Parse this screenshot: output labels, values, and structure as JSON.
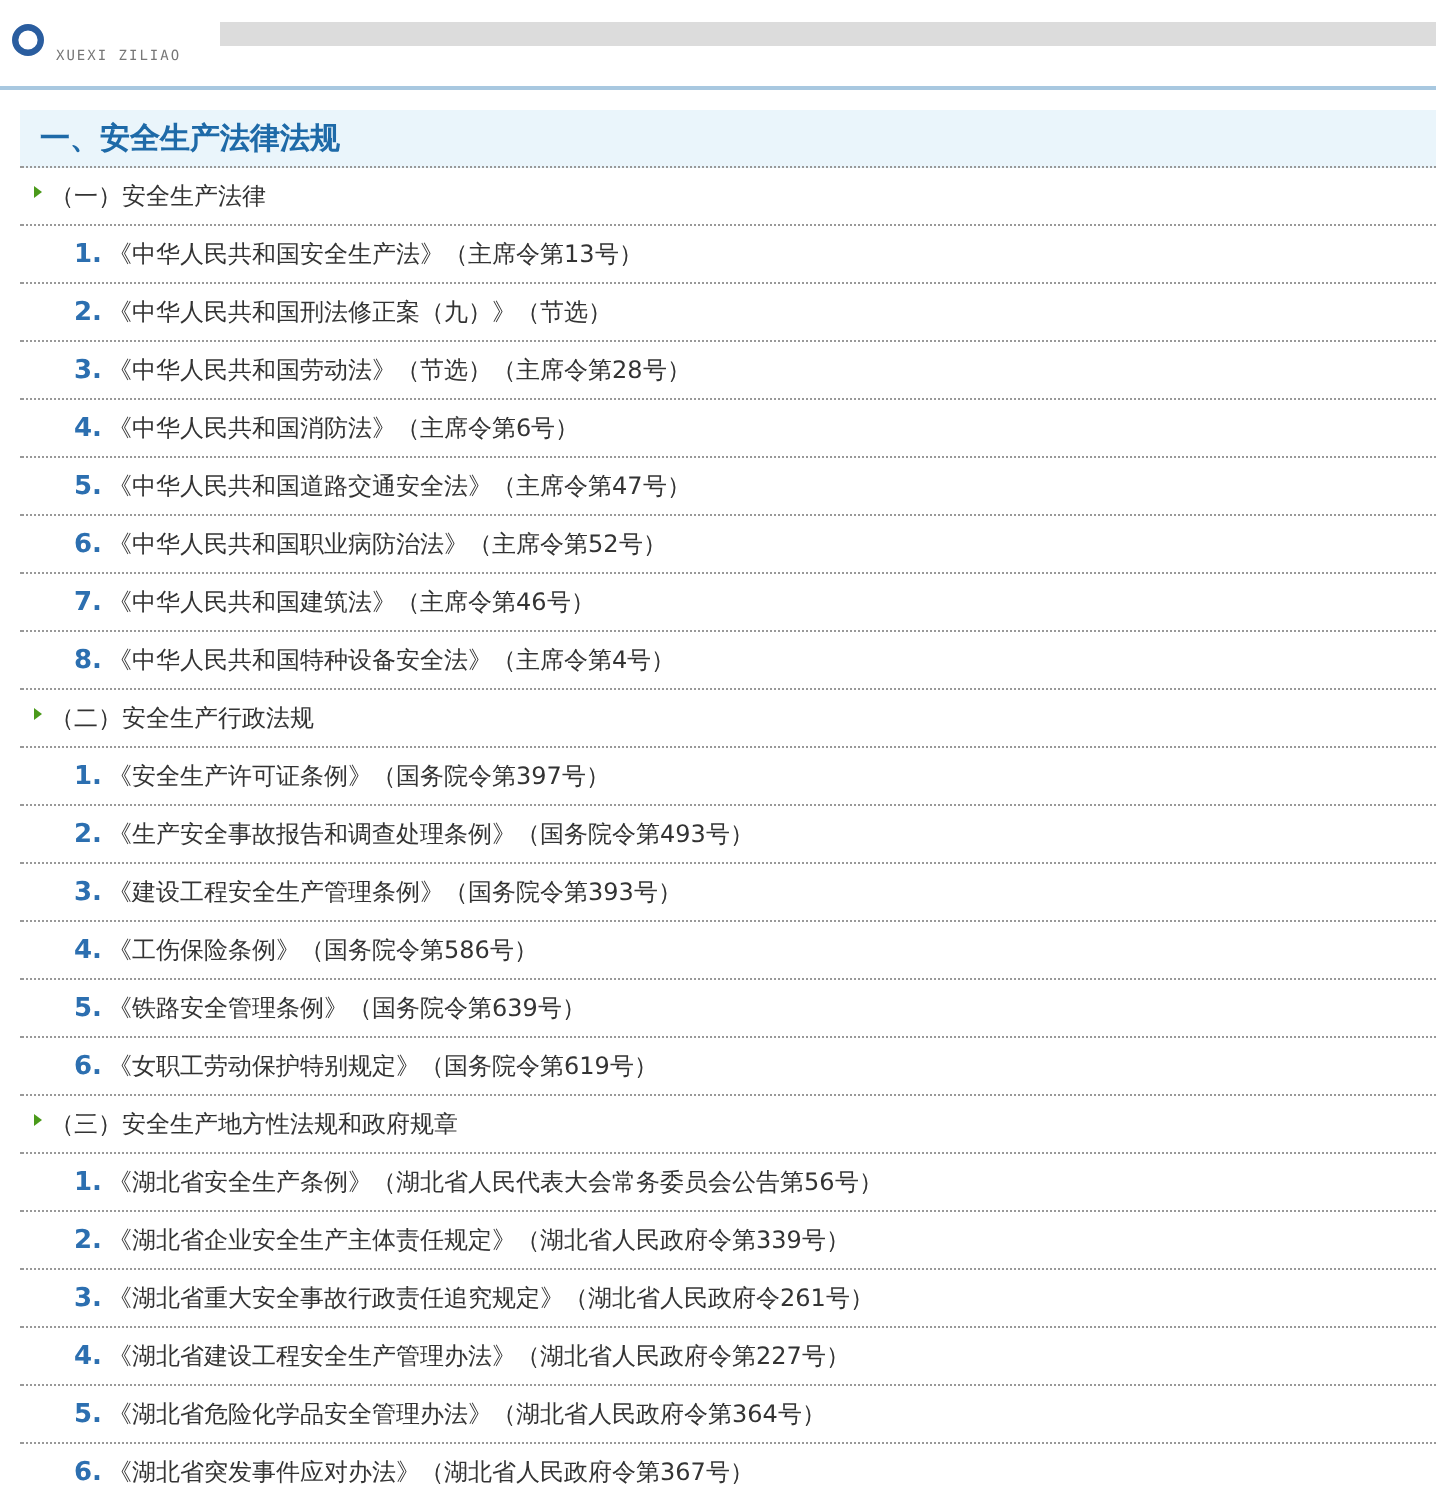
{
  "header": {
    "logo_subtitle": "XUEXI ZILIAO"
  },
  "section": {
    "title": "一、安全生产法律法规",
    "groups": [
      {
        "title": "（一）安全生产法律",
        "items": [
          {
            "number": "1.",
            "text": "《中华人民共和国安全生产法》（主席令第13号）"
          },
          {
            "number": "2.",
            "text": "《中华人民共和国刑法修正案（九）》（节选）"
          },
          {
            "number": "3.",
            "text": "《中华人民共和国劳动法》（节选）（主席令第28号）"
          },
          {
            "number": "4.",
            "text": "《中华人民共和国消防法》（主席令第6号）"
          },
          {
            "number": "5.",
            "text": "《中华人民共和国道路交通安全法》（主席令第47号）"
          },
          {
            "number": "6.",
            "text": "《中华人民共和国职业病防治法》（主席令第52号）"
          },
          {
            "number": "7.",
            "text": "《中华人民共和国建筑法》（主席令第46号）"
          },
          {
            "number": "8.",
            "text": "《中华人民共和国特种设备安全法》（主席令第4号）"
          }
        ]
      },
      {
        "title": "（二）安全生产行政法规",
        "items": [
          {
            "number": "1.",
            "text": "《安全生产许可证条例》（国务院令第397号）"
          },
          {
            "number": "2.",
            "text": "《生产安全事故报告和调查处理条例》（国务院令第493号）"
          },
          {
            "number": "3.",
            "text": "《建设工程安全生产管理条例》（国务院令第393号）"
          },
          {
            "number": "4.",
            "text": "《工伤保险条例》（国务院令第586号）"
          },
          {
            "number": "5.",
            "text": "《铁路安全管理条例》（国务院令第639号）"
          },
          {
            "number": "6.",
            "text": "《女职工劳动保护特别规定》（国务院令第619号）"
          }
        ]
      },
      {
        "title": "（三）安全生产地方性法规和政府规章",
        "items": [
          {
            "number": "1.",
            "text": "《湖北省安全生产条例》（湖北省人民代表大会常务委员会公告第56号）"
          },
          {
            "number": "2.",
            "text": "《湖北省企业安全生产主体责任规定》（湖北省人民政府令第339号）"
          },
          {
            "number": "3.",
            "text": "《湖北省重大安全事故行政责任追究规定》（湖北省人民政府令261号）"
          },
          {
            "number": "4.",
            "text": "《湖北省建设工程安全生产管理办法》（湖北省人民政府令第227号）"
          },
          {
            "number": "5.",
            "text": "《湖北省危险化学品安全管理办法》（湖北省人民政府令第364号）"
          },
          {
            "number": "6.",
            "text": "《湖北省突发事件应对办法》（湖北省人民政府令第367号）"
          }
        ]
      }
    ]
  }
}
